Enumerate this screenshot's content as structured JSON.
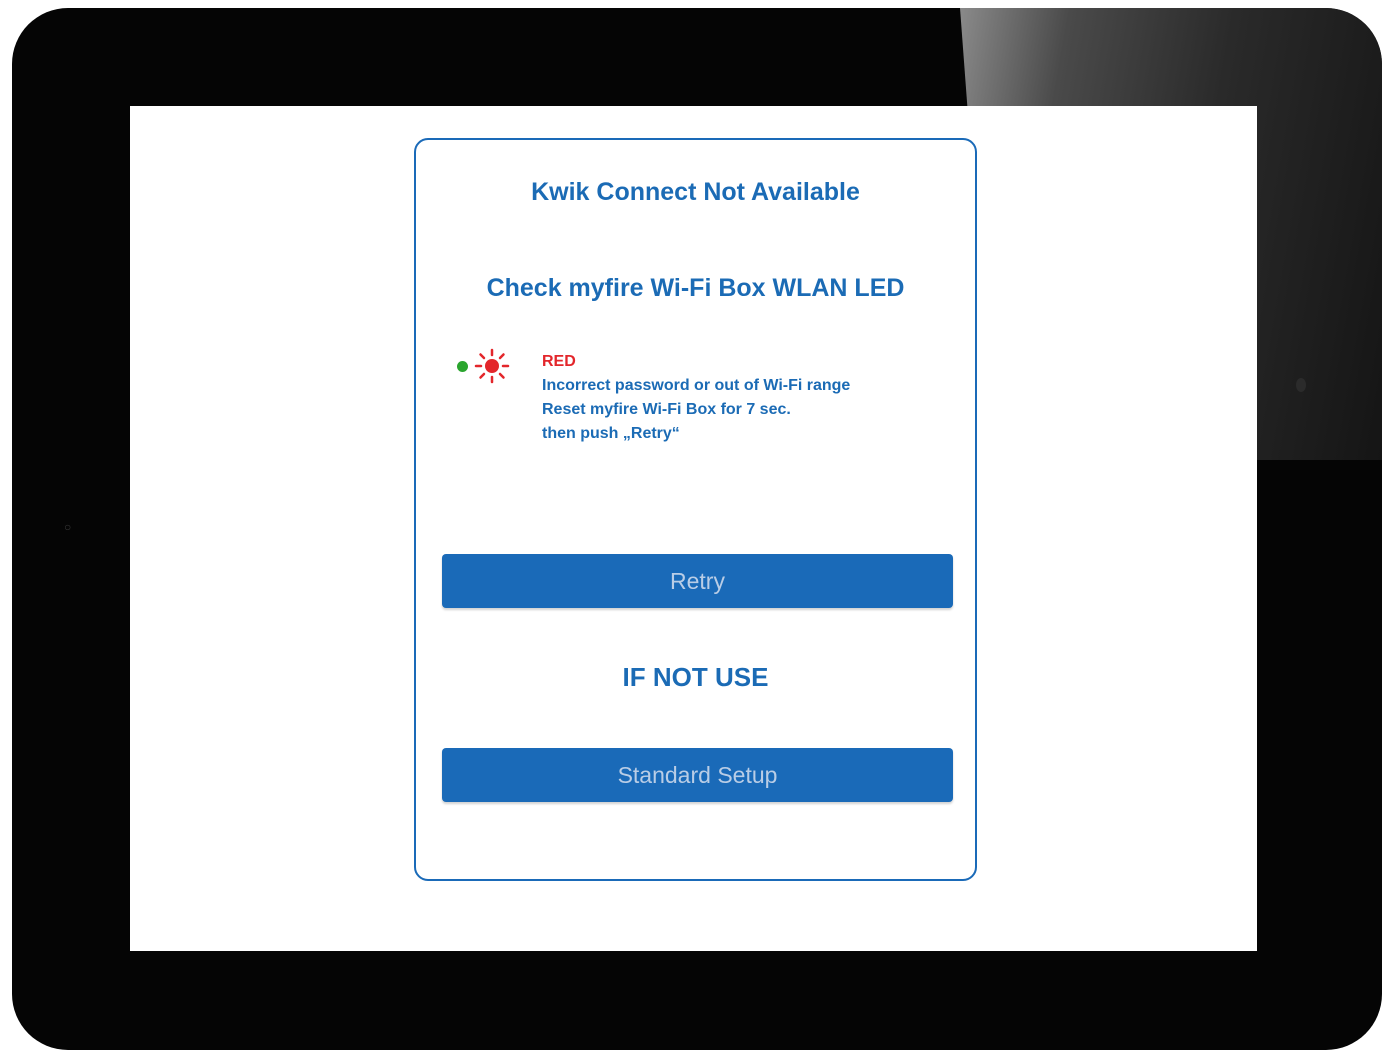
{
  "dialog": {
    "title": "Kwik Connect Not Available",
    "subtitle": "Check myfire Wi-Fi Box WLAN LED",
    "led": {
      "color_label": "RED",
      "lines": [
        "Incorrect password or out of Wi-Fi range",
        "Reset myfire Wi-Fi Box for 7 sec.",
        "then push „Retry“"
      ],
      "icons": [
        "green-led-dot-icon",
        "red-led-blinking-icon"
      ]
    },
    "retry_label": "Retry",
    "if_not_use": "IF NOT USE",
    "standard_setup_label": "Standard Setup"
  },
  "colors": {
    "accent": "#1a6ab8",
    "led_red": "#e3262b",
    "led_green": "#2aa52e",
    "device_bezel": "#050505"
  }
}
